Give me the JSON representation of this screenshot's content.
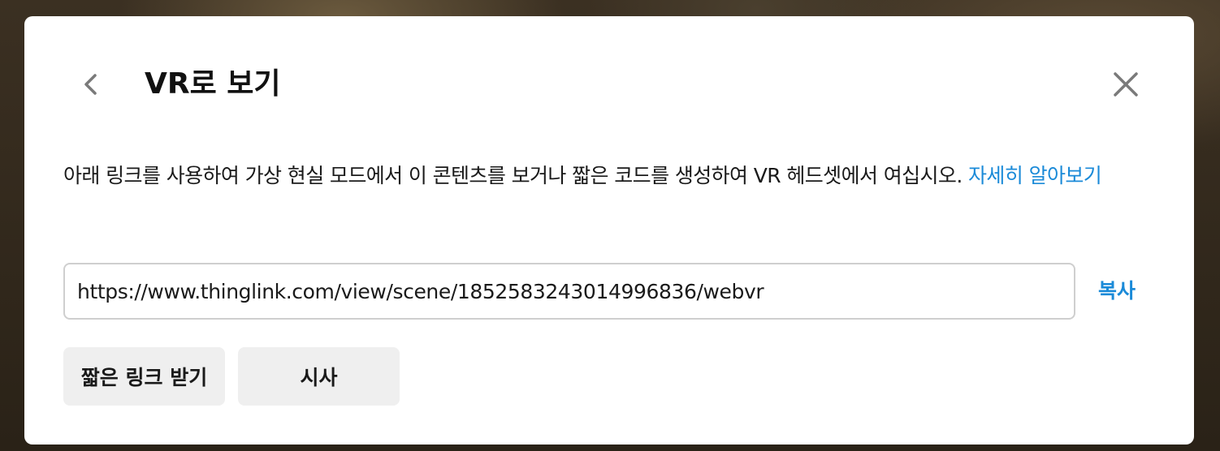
{
  "dialog": {
    "title": "VR로 보기",
    "back_icon": "chevron-left-icon",
    "close_icon": "close-icon",
    "description_text": "아래 링크를 사용하여 가상 현실 모드에서 이 콘텐츠를 보거나 짧은 코드를 생성하여 VR 헤드셋에서 여십시오. ",
    "learn_more_label": "자세히 알아보기",
    "url_value": "https://www.thinglink.com/view/scene/1852583243014996836/webvr",
    "copy_label": "복사",
    "short_link_label": "짧은 링크 받기",
    "preview_label": "시사"
  },
  "colors": {
    "accent": "#1a8ad8",
    "button_bg": "#efefef",
    "text": "#1a1a1a"
  }
}
